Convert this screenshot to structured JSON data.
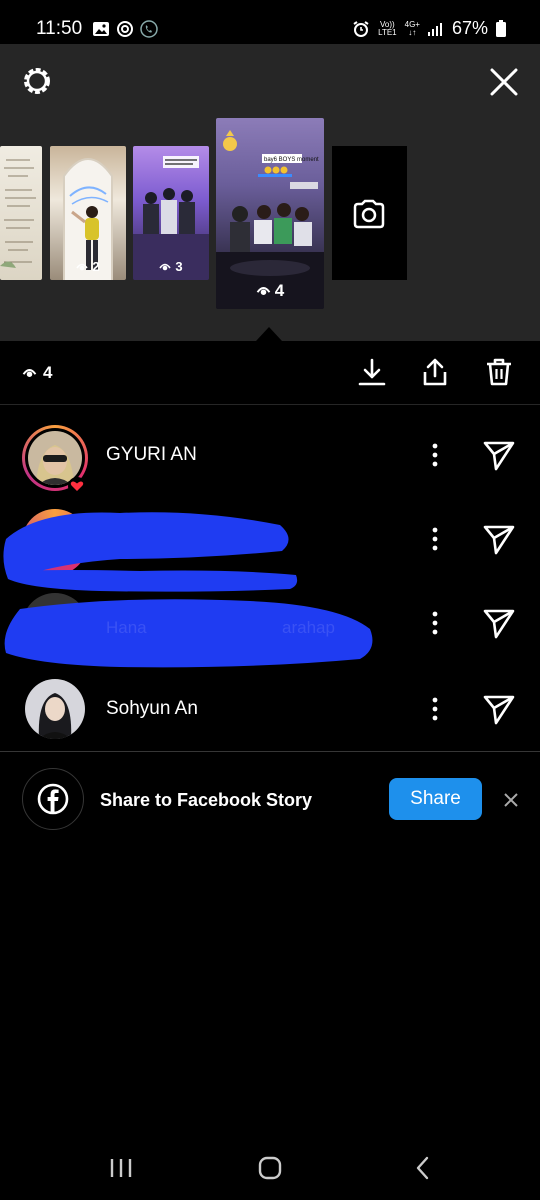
{
  "status_bar": {
    "time": "11:50",
    "network_top": "Vo))",
    "network_bottom": "LTE1",
    "network_type": "4G+",
    "battery": "67%"
  },
  "story_tray": {
    "thumbnails": [
      {
        "views": ""
      },
      {
        "views": "2"
      },
      {
        "views": "3"
      },
      {
        "views": "4",
        "selected": true
      }
    ],
    "thumbnail_3_caption": "bay6 BOYS moment",
    "selected_caption": "bay6 BOYS moment"
  },
  "actions": {
    "views_count": "4"
  },
  "viewers": [
    {
      "name": "GYURI AN",
      "has_story_ring": true,
      "liked": true,
      "redacted": false
    },
    {
      "name": "",
      "has_story_ring": true,
      "liked": false,
      "redacted": true
    },
    {
      "name": "",
      "has_story_ring": false,
      "liked": false,
      "redacted": true
    },
    {
      "name": "Sohyun An",
      "has_story_ring": false,
      "liked": false,
      "redacted": false
    }
  ],
  "redaction_fragments": {
    "row3_left": "Hana",
    "row3_right": "arahap"
  },
  "facebook_share": {
    "label": "Share to Facebook Story",
    "button": "Share"
  },
  "colors": {
    "accent_blue": "#1e90ec",
    "panel_gray": "#262626",
    "scribble_blue": "#1f3cf2",
    "like_red": "#ff3040"
  }
}
